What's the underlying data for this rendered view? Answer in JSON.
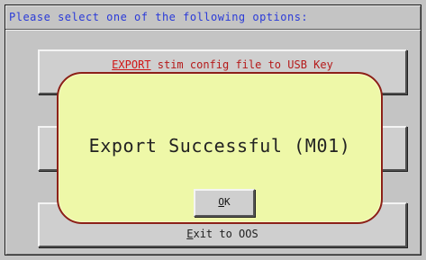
{
  "prompt": "Please select one of the following options:",
  "options": [
    {
      "label_hot": "EXPORT",
      "label_rest": " stim config file to USB Key"
    },
    {
      "label": ""
    },
    {
      "label_hot": "E",
      "label_rest": "xit to OOS"
    }
  ],
  "popup": {
    "message": "Export Successful (M01)",
    "ok_hot": "O",
    "ok_rest": "K"
  },
  "colors": {
    "background": "#c4c4c4",
    "prompt_text": "#2a3ad8",
    "popup_fill": "#eef8a8",
    "popup_border": "#8c2018",
    "hotkey_red": "#d01616"
  }
}
